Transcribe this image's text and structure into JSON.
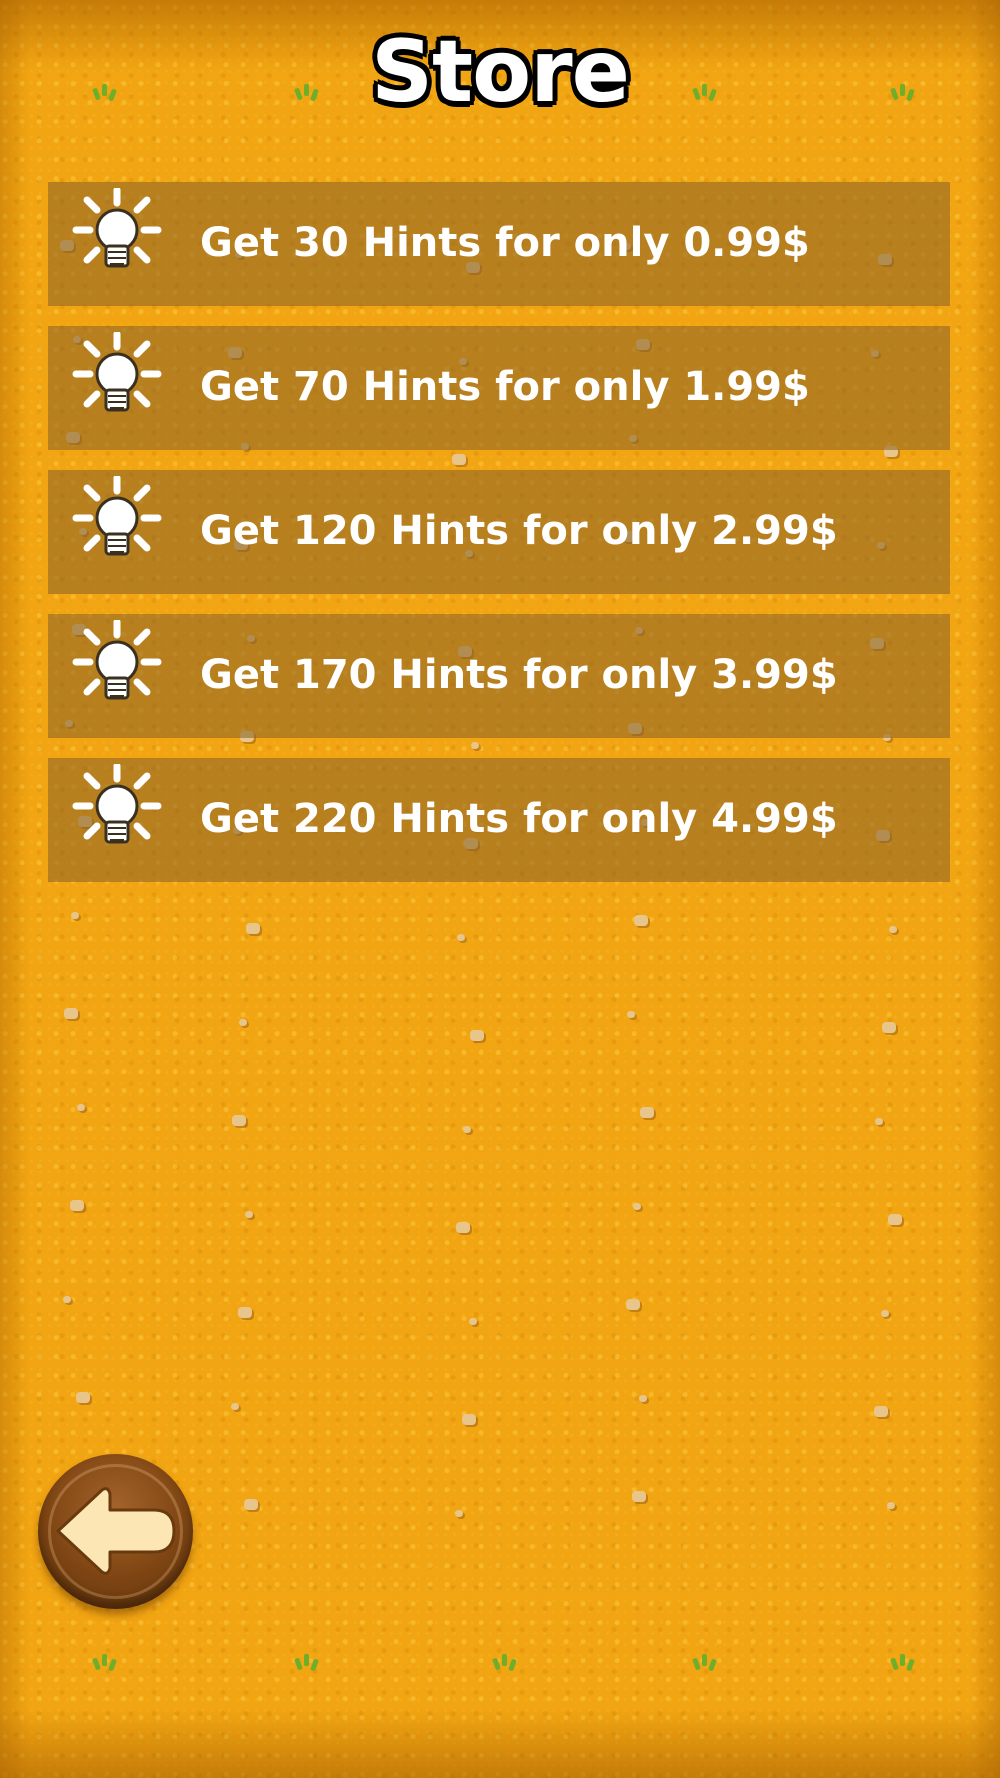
{
  "screen": {
    "title": "Store",
    "background_color": "#f2a512"
  },
  "offers": [
    {
      "label": "Get 30 Hints for only 0.99$",
      "icon": "lightbulb-icon"
    },
    {
      "label": "Get 70 Hints for only 1.99$",
      "icon": "lightbulb-icon"
    },
    {
      "label": "Get 120 Hints for only 2.99$",
      "icon": "lightbulb-icon"
    },
    {
      "label": "Get 170 Hints for only 3.99$",
      "icon": "lightbulb-icon"
    },
    {
      "label": "Get 220 Hints for only 4.99$",
      "icon": "lightbulb-icon"
    }
  ],
  "back_button": {
    "icon": "back-arrow-icon",
    "color": "#7e4513",
    "arrow_color": "#fbe6b4"
  }
}
